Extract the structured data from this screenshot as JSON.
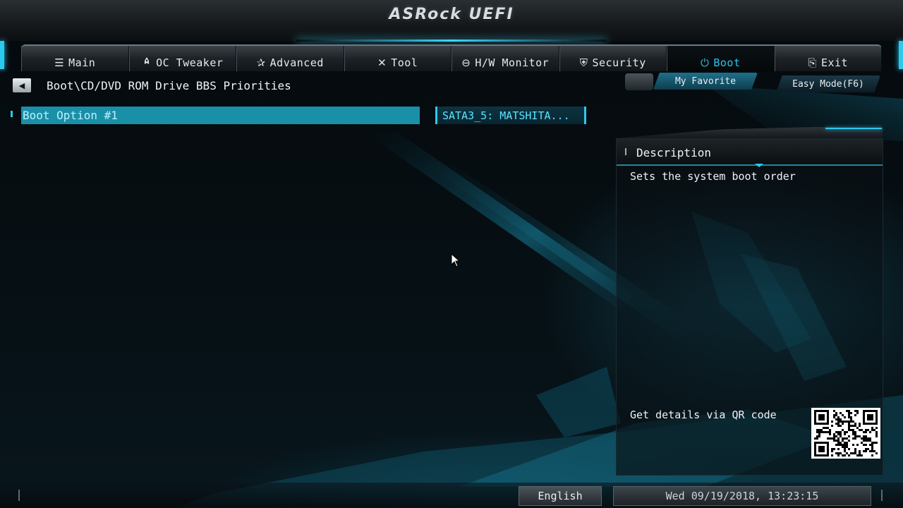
{
  "header": {
    "logo_text": "ASRock UEFI"
  },
  "nav": {
    "tabs": [
      {
        "label": "Main",
        "icon": "list-icon",
        "glyph": "☰"
      },
      {
        "label": "OC Tweaker",
        "icon": "rocket-icon",
        "glyph": "🚀"
      },
      {
        "label": "Advanced",
        "icon": "star-icon",
        "glyph": "✰"
      },
      {
        "label": "Tool",
        "icon": "tools-icon",
        "glyph": "✕"
      },
      {
        "label": "H/W Monitor",
        "icon": "monitor-icon",
        "glyph": "⊖"
      },
      {
        "label": "Security",
        "icon": "shield-icon",
        "glyph": "⛨"
      },
      {
        "label": "Boot",
        "icon": "power-icon",
        "glyph": "⏻",
        "active": true
      },
      {
        "label": "Exit",
        "icon": "exit-icon",
        "glyph": "⎘"
      }
    ]
  },
  "breadcrumb": {
    "path": "Boot\\CD/DVD ROM Drive BBS Priorities",
    "back_glyph": "◀"
  },
  "toolbar": {
    "favorite_label": "My Favorite",
    "easy_mode_label": "Easy Mode(F6)"
  },
  "options": [
    {
      "label": "Boot Option #1",
      "value": "SATA3_5: MATSHITA..."
    }
  ],
  "description": {
    "title": "Description",
    "text": "Sets the system boot order",
    "qr_label": "Get details via QR code"
  },
  "status": {
    "language": "English",
    "datetime": "Wed 09/19/2018, 13:23:15"
  },
  "colors": {
    "accent": "#2cc9ef",
    "selected_row": "#1a8fa8"
  }
}
